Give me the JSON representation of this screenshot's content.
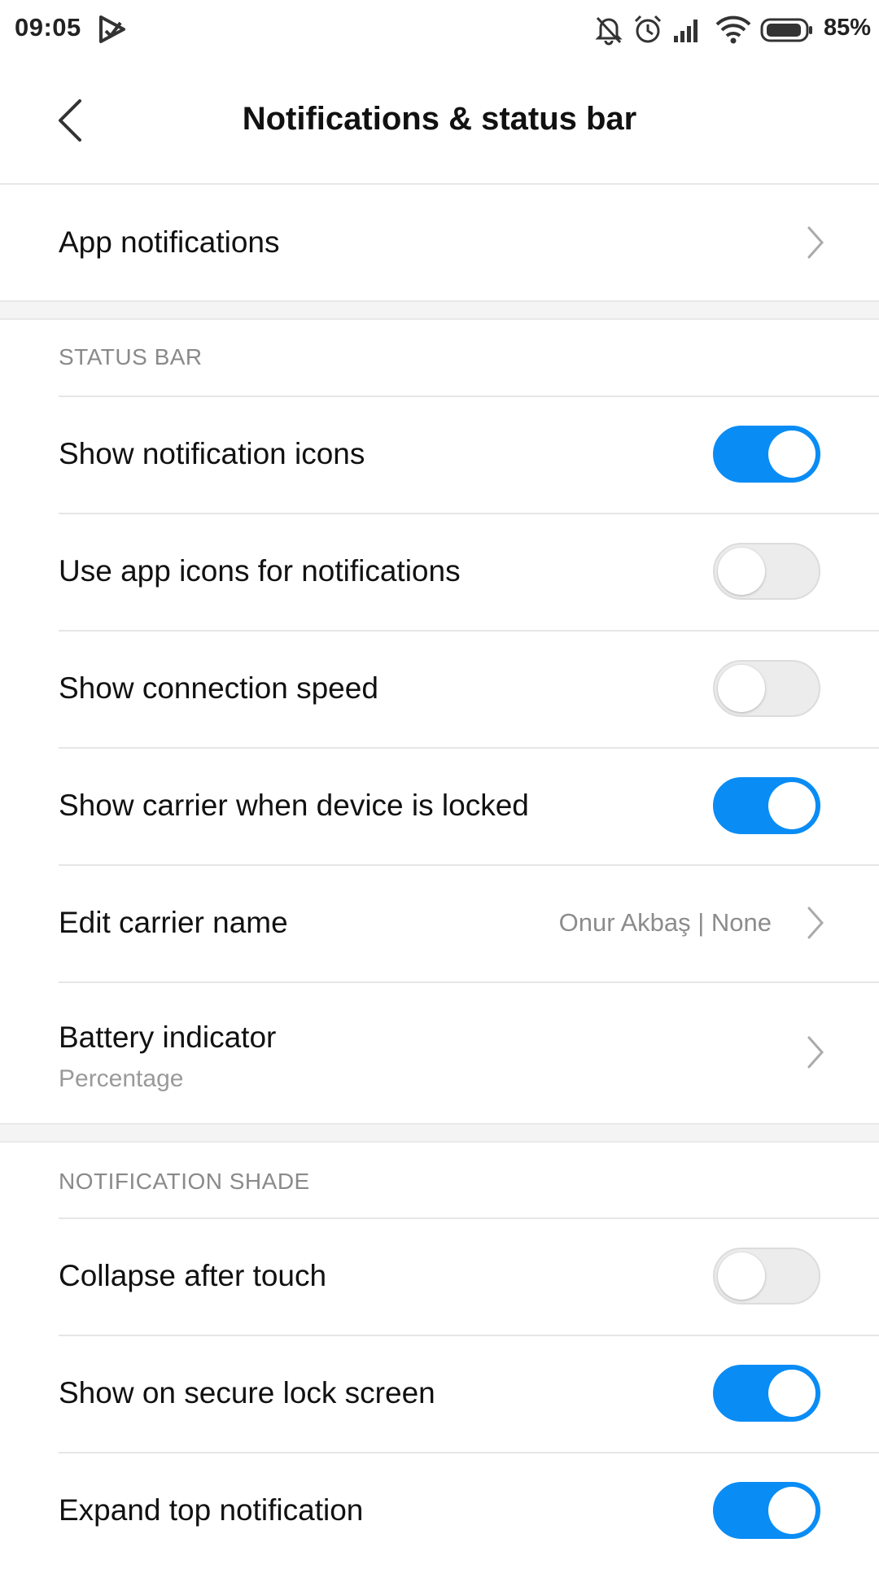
{
  "status_bar": {
    "time": "09:05",
    "battery_percent": "85%",
    "icons": [
      "play-store-icon",
      "bell-off-icon",
      "alarm-icon",
      "signal-icon",
      "wifi-icon",
      "battery-icon"
    ]
  },
  "header": {
    "title": "Notifications & status bar",
    "back_icon": "chevron-left-icon"
  },
  "app_notifications": {
    "label": "App notifications"
  },
  "status_bar_section": {
    "label": "STATUS BAR",
    "show_notification_icons": {
      "label": "Show notification icons",
      "enabled": true
    },
    "use_app_icons": {
      "label": "Use app icons for notifications",
      "enabled": false
    },
    "show_connection_speed": {
      "label": "Show connection speed",
      "enabled": false
    },
    "show_carrier_locked": {
      "label": "Show carrier when device is locked",
      "enabled": true
    },
    "edit_carrier_name": {
      "label": "Edit carrier name",
      "value": "Onur Akbaş | None"
    },
    "battery_indicator": {
      "label": "Battery indicator",
      "subtitle": "Percentage"
    }
  },
  "notification_shade_section": {
    "label": "NOTIFICATION SHADE",
    "collapse_after_touch": {
      "label": "Collapse after touch",
      "enabled": false
    },
    "show_on_secure_lock": {
      "label": "Show on secure lock screen",
      "enabled": true
    },
    "expand_top_notification": {
      "label": "Expand top notification",
      "enabled": true
    }
  },
  "colors": {
    "accent": "#0a8cf5",
    "toggle_off": "#ececec",
    "section_label": "#8a8a8a",
    "background_gap": "#f4f4f4"
  }
}
